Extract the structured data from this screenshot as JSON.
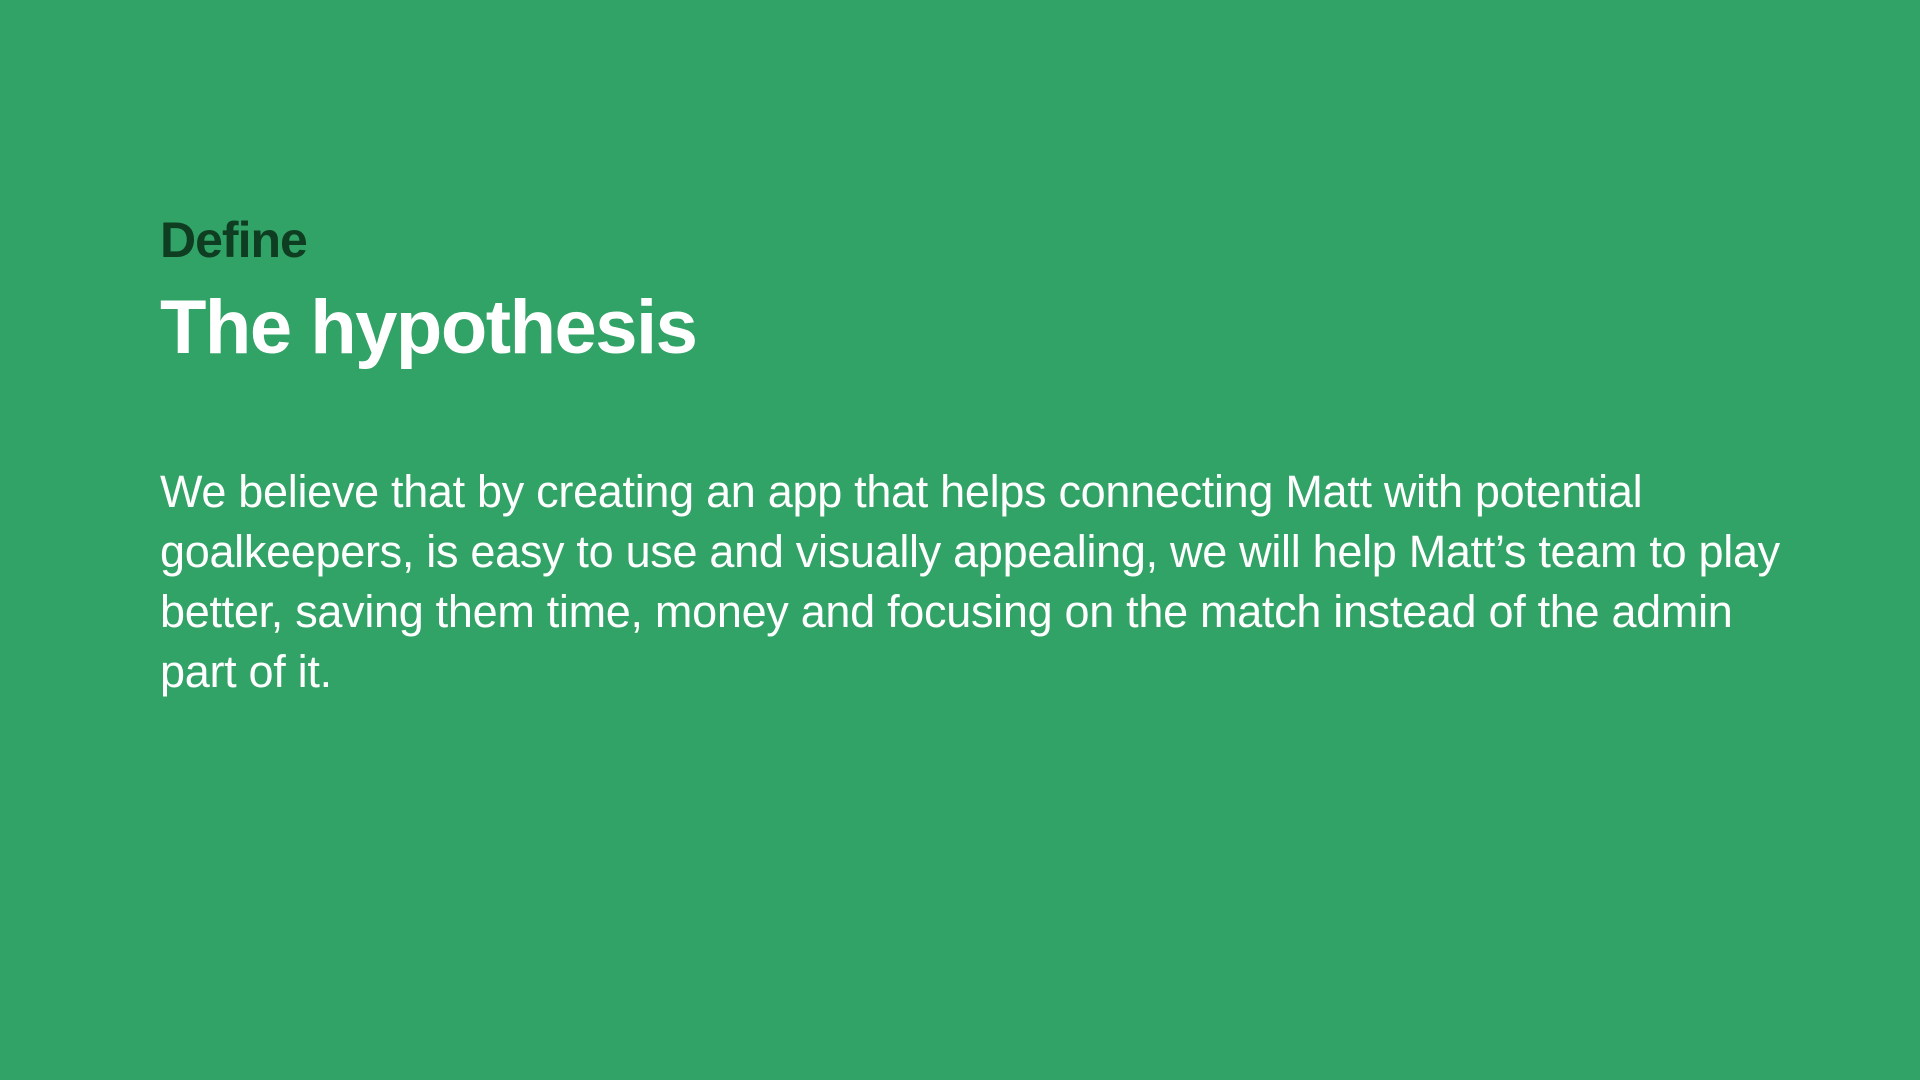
{
  "slide": {
    "background_color": "#32a366",
    "eyebrow": "Define",
    "eyebrow_color": "#0f3d22",
    "title": "The hypothesis",
    "title_color": "#ffffff",
    "body": "We believe that by creating an app that helps connecting Matt with potential goalkeepers, is easy to use and visually appealing, we will help Matt’s team to play better, saving them time, money and focusing on the match instead of the admin part of it.",
    "body_color": "#ffffff"
  }
}
